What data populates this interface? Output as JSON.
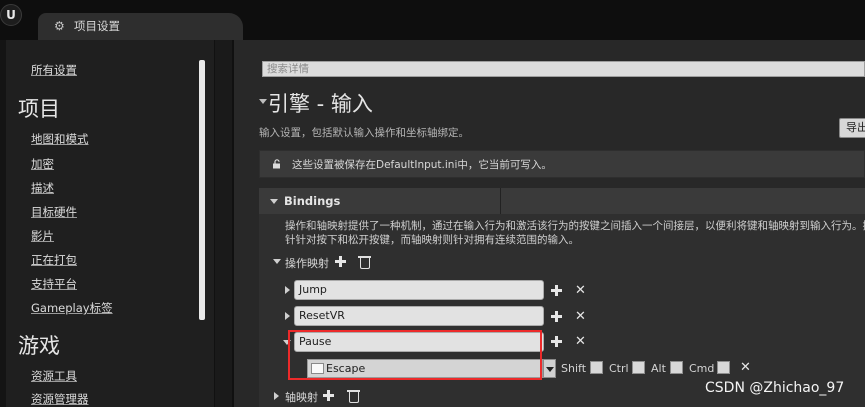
{
  "window": {
    "logo_text": "U",
    "tab_title": "项目设置"
  },
  "sidebar": {
    "all_settings": "所有设置",
    "project_heading": "项目",
    "project_items": [
      "地图和模式",
      "加密",
      "描述",
      "目标硬件",
      "影片",
      "正在打包",
      "支持平台",
      "Gameplay标签"
    ],
    "game_heading": "游戏",
    "game_items": [
      "资源工具",
      "资源管理器"
    ]
  },
  "details": {
    "search_placeholder": "搜索详情",
    "title": "引擎 - 输入",
    "description": "输入设置，包括默认输入操作和坐标轴绑定。",
    "export_label": "导出",
    "notice": "这些设置被保存在DefaultInput.ini中，它当前可写入。"
  },
  "bindings": {
    "label": "Bindings",
    "desc_line1": "操作和轴映射提供了一种机制，通过在输入行为和激活该行为的按键之间插入一个间接层，以便利将键和轴映射到输入行为。操作映射",
    "desc_line2": "针针对按下和松开按键，而轴映射则针对拥有连续范围的输入。",
    "action_mappings_label": "操作映射",
    "actions": [
      "Jump",
      "ResetVR",
      "Pause"
    ],
    "pause_key": "Escape",
    "modifiers": [
      "Shift",
      "Ctrl",
      "Alt",
      "Cmd"
    ],
    "axis_mappings_label": "轴映射"
  },
  "watermark": "CSDN @Zhichao_97"
}
